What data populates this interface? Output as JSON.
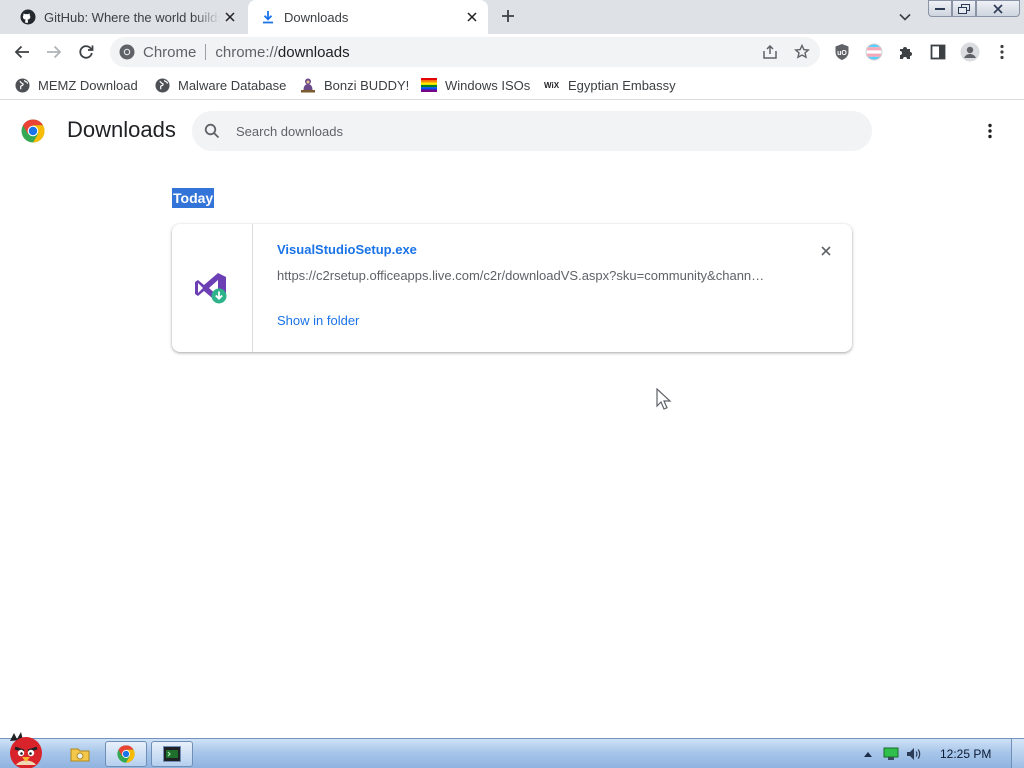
{
  "browser": {
    "tabs": [
      {
        "title": "GitHub: Where the world builds software",
        "icon": "github-icon",
        "active": false
      },
      {
        "title": "Downloads",
        "icon": "download-icon",
        "active": true
      }
    ],
    "omnibox": {
      "origin_label": "Chrome",
      "url_prefix": "chrome://",
      "url_path": "downloads"
    },
    "bookmarks": [
      {
        "label": "MEMZ Download",
        "icon": "globe-icon"
      },
      {
        "label": "Malware Database",
        "icon": "globe-icon"
      },
      {
        "label": "Bonzi BUDDY!",
        "icon": "bonzi-icon"
      },
      {
        "label": "Windows ISOs",
        "icon": "rainbow-flag-icon"
      },
      {
        "label": "Egyptian Embassy",
        "icon": "wix-icon"
      }
    ]
  },
  "page": {
    "title": "Downloads",
    "search_placeholder": "Search downloads",
    "date_group": "Today",
    "downloads": [
      {
        "file_name": "VisualStudioSetup.exe",
        "url": "https://c2rsetup.officeapps.live.com/c2r/downloadVS.aspx?sku=community&chann…",
        "action_label": "Show in folder",
        "icon": "visual-studio-icon"
      }
    ]
  },
  "taskbar": {
    "clock": "12:25 PM"
  },
  "colors": {
    "accent": "#1a73e8",
    "selection": "#3374d8",
    "tabstrip": "#dee1e6"
  }
}
